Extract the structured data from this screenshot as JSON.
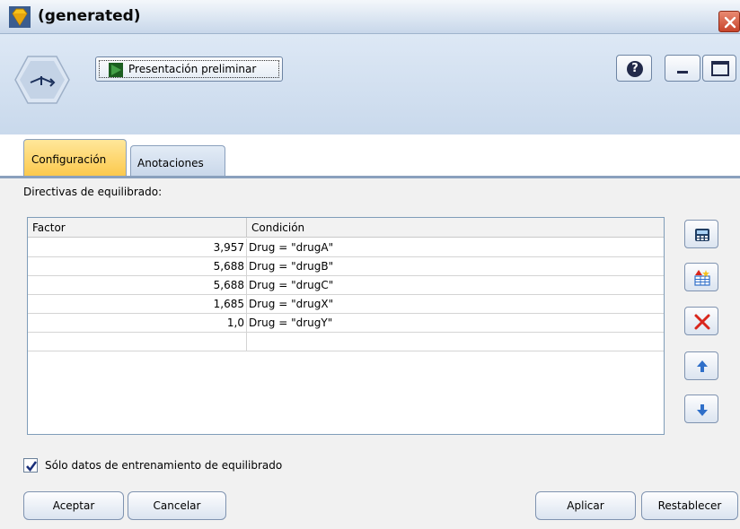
{
  "window": {
    "title": "(generated)"
  },
  "toolbar": {
    "preview_label": "Presentación preliminar",
    "help_symbol": "?"
  },
  "tabs": [
    {
      "label": "Configuración",
      "active": true
    },
    {
      "label": "Anotaciones",
      "active": false
    }
  ],
  "section_label": "Directivas de equilibrado:",
  "table": {
    "headers": [
      "Factor",
      "Condición"
    ],
    "rows": [
      {
        "factor": "3,957",
        "condition": "Drug = \"drugA\""
      },
      {
        "factor": "5,688",
        "condition": "Drug = \"drugB\""
      },
      {
        "factor": "5,688",
        "condition": "Drug = \"drugC\""
      },
      {
        "factor": "1,685",
        "condition": "Drug = \"drugX\""
      },
      {
        "factor": "1,0",
        "condition": "Drug = \"drugY\""
      },
      {
        "factor": "",
        "condition": ""
      }
    ]
  },
  "side_buttons": [
    "calculator-icon",
    "add-row-icon",
    "delete-icon",
    "move-up-icon",
    "move-down-icon"
  ],
  "checkbox": {
    "label": "Sólo datos de entrenamiento de equilibrado",
    "checked": true
  },
  "buttons": {
    "ok": "Aceptar",
    "cancel": "Cancelar",
    "apply": "Aplicar",
    "reset": "Restablecer"
  },
  "colors": {
    "active_tab": "#fcc94d",
    "close_button": "#c7432a",
    "delete_icon": "#d9261c",
    "arrow_icon": "#2f6fc9"
  }
}
